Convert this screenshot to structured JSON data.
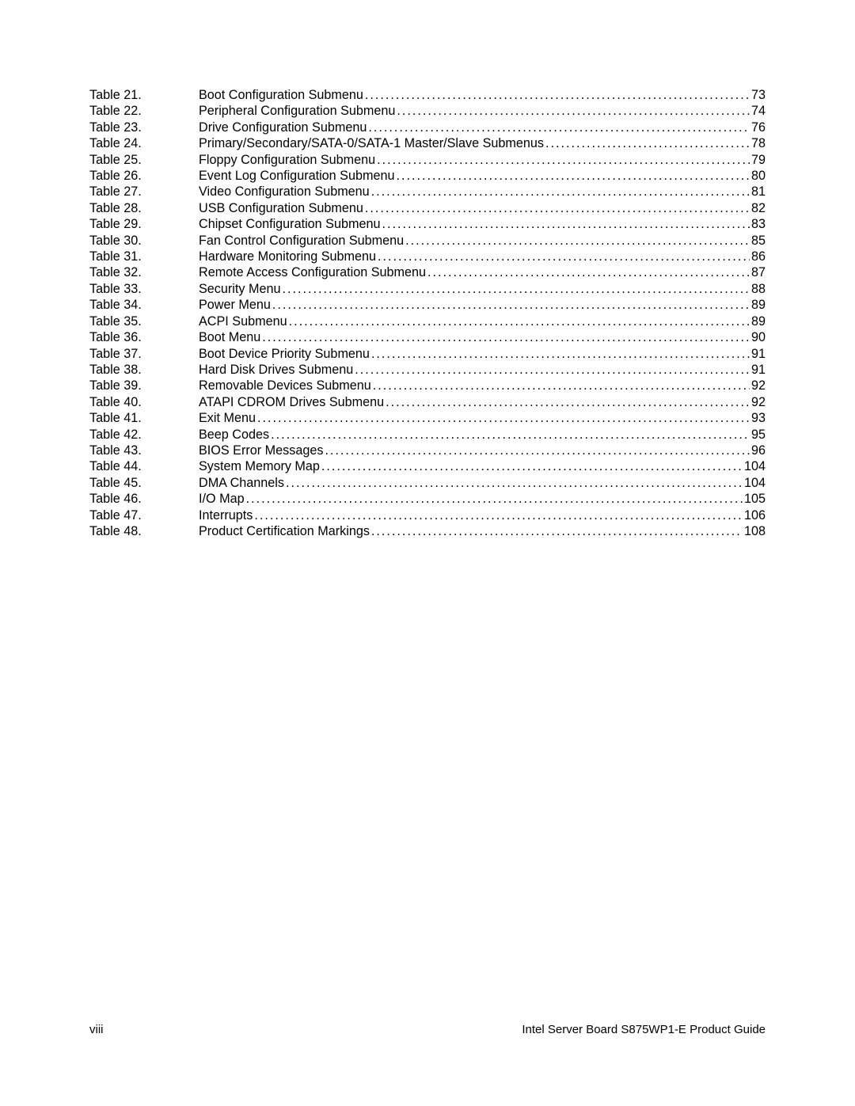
{
  "toc": [
    {
      "label": "Table 21.",
      "title": "Boot Configuration Submenu ",
      "page": "73"
    },
    {
      "label": "Table 22.",
      "title": "Peripheral Configuration Submenu ",
      "page": "74"
    },
    {
      "label": "Table 23.",
      "title": "Drive Configuration Submenu ",
      "page": "76"
    },
    {
      "label": "Table 24.",
      "title": "Primary/Secondary/SATA-0/SATA-1 Master/Slave Submenus",
      "page": "78"
    },
    {
      "label": "Table 25.",
      "title": "Floppy Configuration Submenu",
      "page": "79"
    },
    {
      "label": "Table 26.",
      "title": "Event Log Configuration Submenu",
      "page": "80"
    },
    {
      "label": "Table 27.",
      "title": "Video Configuration Submenu",
      "page": "81"
    },
    {
      "label": "Table 28.",
      "title": "USB Configuration Submenu ",
      "page": "82"
    },
    {
      "label": "Table 29.",
      "title": "Chipset Configuration Submenu",
      "page": "83"
    },
    {
      "label": "Table 30.",
      "title": "Fan Control Configuration Submenu ",
      "page": "85"
    },
    {
      "label": "Table 31.",
      "title": "Hardware Monitoring Submenu",
      "page": "86"
    },
    {
      "label": "Table 32.",
      "title": "Remote Access Configuration Submenu",
      "page": "87"
    },
    {
      "label": "Table 33.",
      "title": "Security Menu",
      "page": "88"
    },
    {
      "label": "Table 34.",
      "title": "Power Menu ",
      "page": "89"
    },
    {
      "label": "Table 35.",
      "title": "ACPI Submenu",
      "page": "89"
    },
    {
      "label": "Table 36.",
      "title": "Boot Menu ",
      "page": "90"
    },
    {
      "label": "Table 37.",
      "title": "Boot Device Priority Submenu",
      "page": "91"
    },
    {
      "label": "Table 38.",
      "title": "Hard Disk Drives Submenu ",
      "page": "91"
    },
    {
      "label": "Table 39.",
      "title": "Removable Devices Submenu ",
      "page": "92"
    },
    {
      "label": "Table 40.",
      "title": "ATAPI CDROM Drives Submenu ",
      "page": "92"
    },
    {
      "label": "Table 41.",
      "title": "Exit Menu",
      "page": "93"
    },
    {
      "label": "Table 42.",
      "title": "Beep Codes",
      "page": "95"
    },
    {
      "label": "Table 43.",
      "title": "BIOS Error Messages",
      "page": "96"
    },
    {
      "label": "Table 44.",
      "title": "System Memory Map",
      "page": "104"
    },
    {
      "label": "Table 45.",
      "title": "DMA Channels ",
      "page": "104"
    },
    {
      "label": "Table 46.",
      "title": "I/O Map",
      "page": "105"
    },
    {
      "label": "Table 47.",
      "title": "Interrupts ",
      "page": "106"
    },
    {
      "label": "Table 48.",
      "title": "Product Certification Markings",
      "page": "108"
    }
  ],
  "footer": {
    "page_number": "viii",
    "doc_title": "Intel Server Board S875WP1-E Product Guide"
  }
}
